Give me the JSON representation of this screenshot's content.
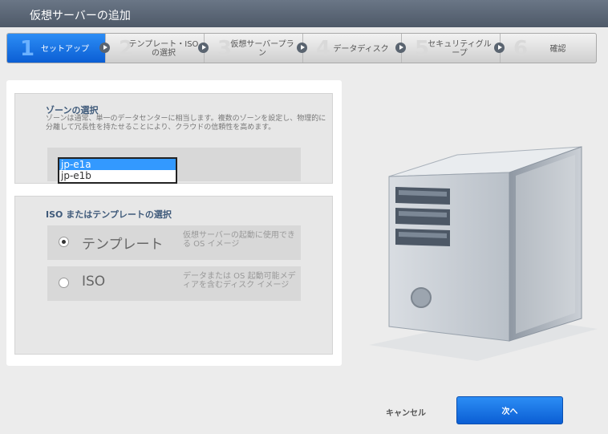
{
  "window": {
    "title": "仮想サーバーの追加"
  },
  "steps": [
    {
      "num": "1",
      "label": "セットアップ"
    },
    {
      "num": "2",
      "label": "テンプレート・ISO の選択"
    },
    {
      "num": "3",
      "label": "仮想サーバープラン"
    },
    {
      "num": "4",
      "label": "データディスク"
    },
    {
      "num": "5",
      "label": "セキュリティグループ"
    },
    {
      "num": "6",
      "label": "確認"
    }
  ],
  "zone": {
    "title": "ゾーンの選択",
    "description": "ゾーンは通常、単一のデータセンターに相当します。複数のゾーンを設定し、物理的に分離して冗長性を持たせることにより、クラウドの信頼性を高めます。",
    "options": [
      "jp-e1a",
      "jp-e1b"
    ],
    "selected": "jp-e1a"
  },
  "source": {
    "title": "ISO またはテンプレートの選択",
    "template": {
      "label": "テンプレート",
      "desc": "仮想サーバーの起動に使用できる OS イメージ"
    },
    "iso": {
      "label": "ISO",
      "desc": "データまたは OS 起動可能メディアを含むディスク イメージ"
    }
  },
  "actions": {
    "cancel": "キャンセル",
    "next": "次へ"
  },
  "colors": {
    "accent": "#0b5ed4",
    "titlebar": "#4e5968",
    "section_title": "#3f5a7a"
  }
}
